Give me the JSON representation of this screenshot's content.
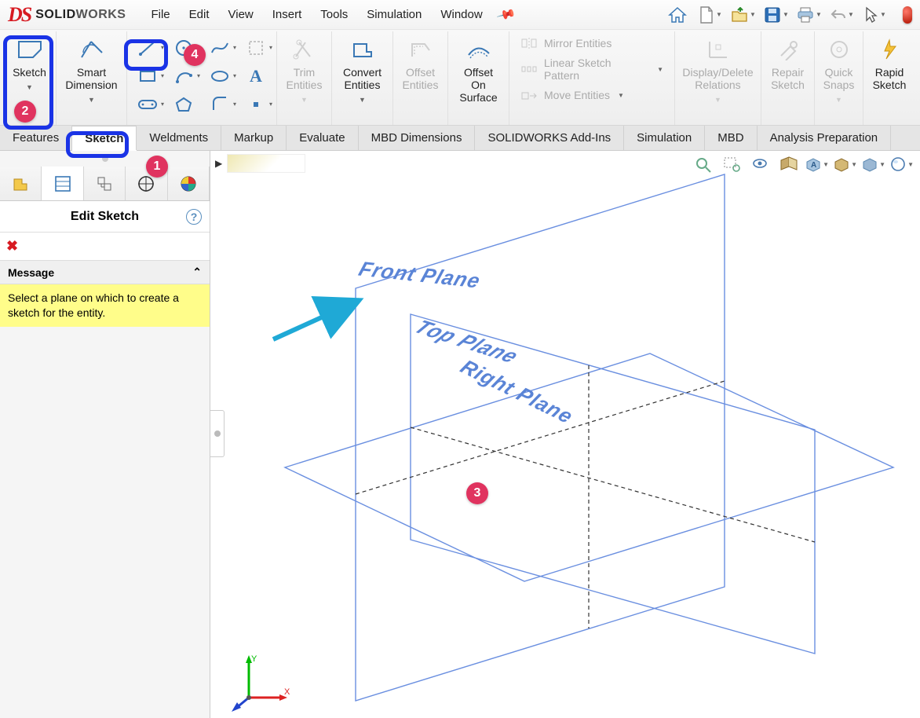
{
  "app": {
    "logo_prefix": "SOLID",
    "logo_suffix": "WORKS"
  },
  "menu": [
    "File",
    "Edit",
    "View",
    "Insert",
    "Tools",
    "Simulation",
    "Window"
  ],
  "ribbon": {
    "sketch_label": "Sketch",
    "smart_dimension_label": "Smart\nDimension",
    "trim_label": "Trim\nEntities",
    "convert_label": "Convert\nEntities",
    "offset_label": "Offset\nEntities",
    "offset_surface_label": "Offset\nOn\nSurface",
    "mirror_label": "Mirror Entities",
    "pattern_label": "Linear Sketch Pattern",
    "move_label": "Move Entities",
    "display_label": "Display/Delete\nRelations",
    "repair_label": "Repair\nSketch",
    "quick_label": "Quick\nSnaps",
    "rapid_label": "Rapid\nSketch"
  },
  "tabs": [
    "Features",
    "Sketch",
    "Weldments",
    "Markup",
    "Evaluate",
    "MBD Dimensions",
    "SOLIDWORKS Add-Ins",
    "Simulation",
    "MBD",
    "Analysis Preparation"
  ],
  "panel": {
    "title": "Edit Sketch",
    "msg_header": "Message",
    "msg_body": "Select a plane on which to create a sketch for the entity."
  },
  "planes": {
    "front": "Front Plane",
    "top": "Top Plane",
    "right": "Right Plane"
  },
  "annotations": {
    "b1": "1",
    "b2": "2",
    "b3": "3",
    "b4": "4"
  }
}
